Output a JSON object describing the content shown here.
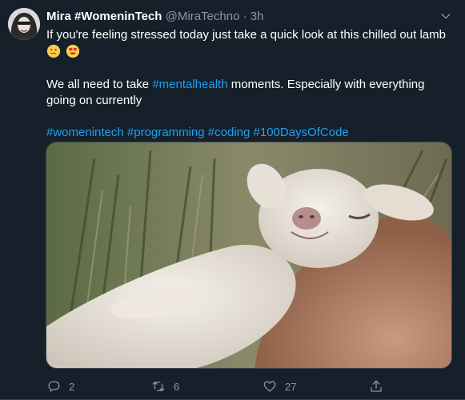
{
  "tweet": {
    "display_name": "Mira #WomeninTech",
    "handle": "@MiraTechno",
    "separator": "·",
    "time": "3h",
    "line1": "If you're feeling stressed today just take a quick look at this chilled out lamb",
    "line2_prefix": "We all need to take ",
    "line2_tag": "#mentalhealth",
    "line2_suffix": " moments. Especially with everything going on currently",
    "hashtags": [
      "#womenintech",
      "#programming",
      "#coding",
      "#100DaysOfCode"
    ]
  },
  "actions": {
    "replies": "2",
    "retweets": "6",
    "likes": "27"
  },
  "colors": {
    "background": "#15202b",
    "text": "#ffffff",
    "muted": "#8899a6",
    "link": "#1da1f2",
    "border": "#38444d"
  },
  "icons": [
    "reply-icon",
    "retweet-icon",
    "heart-icon",
    "share-icon",
    "chevron-down-icon"
  ],
  "media": {
    "alt": "Chilled out lamb resting its head on a person's arm"
  }
}
